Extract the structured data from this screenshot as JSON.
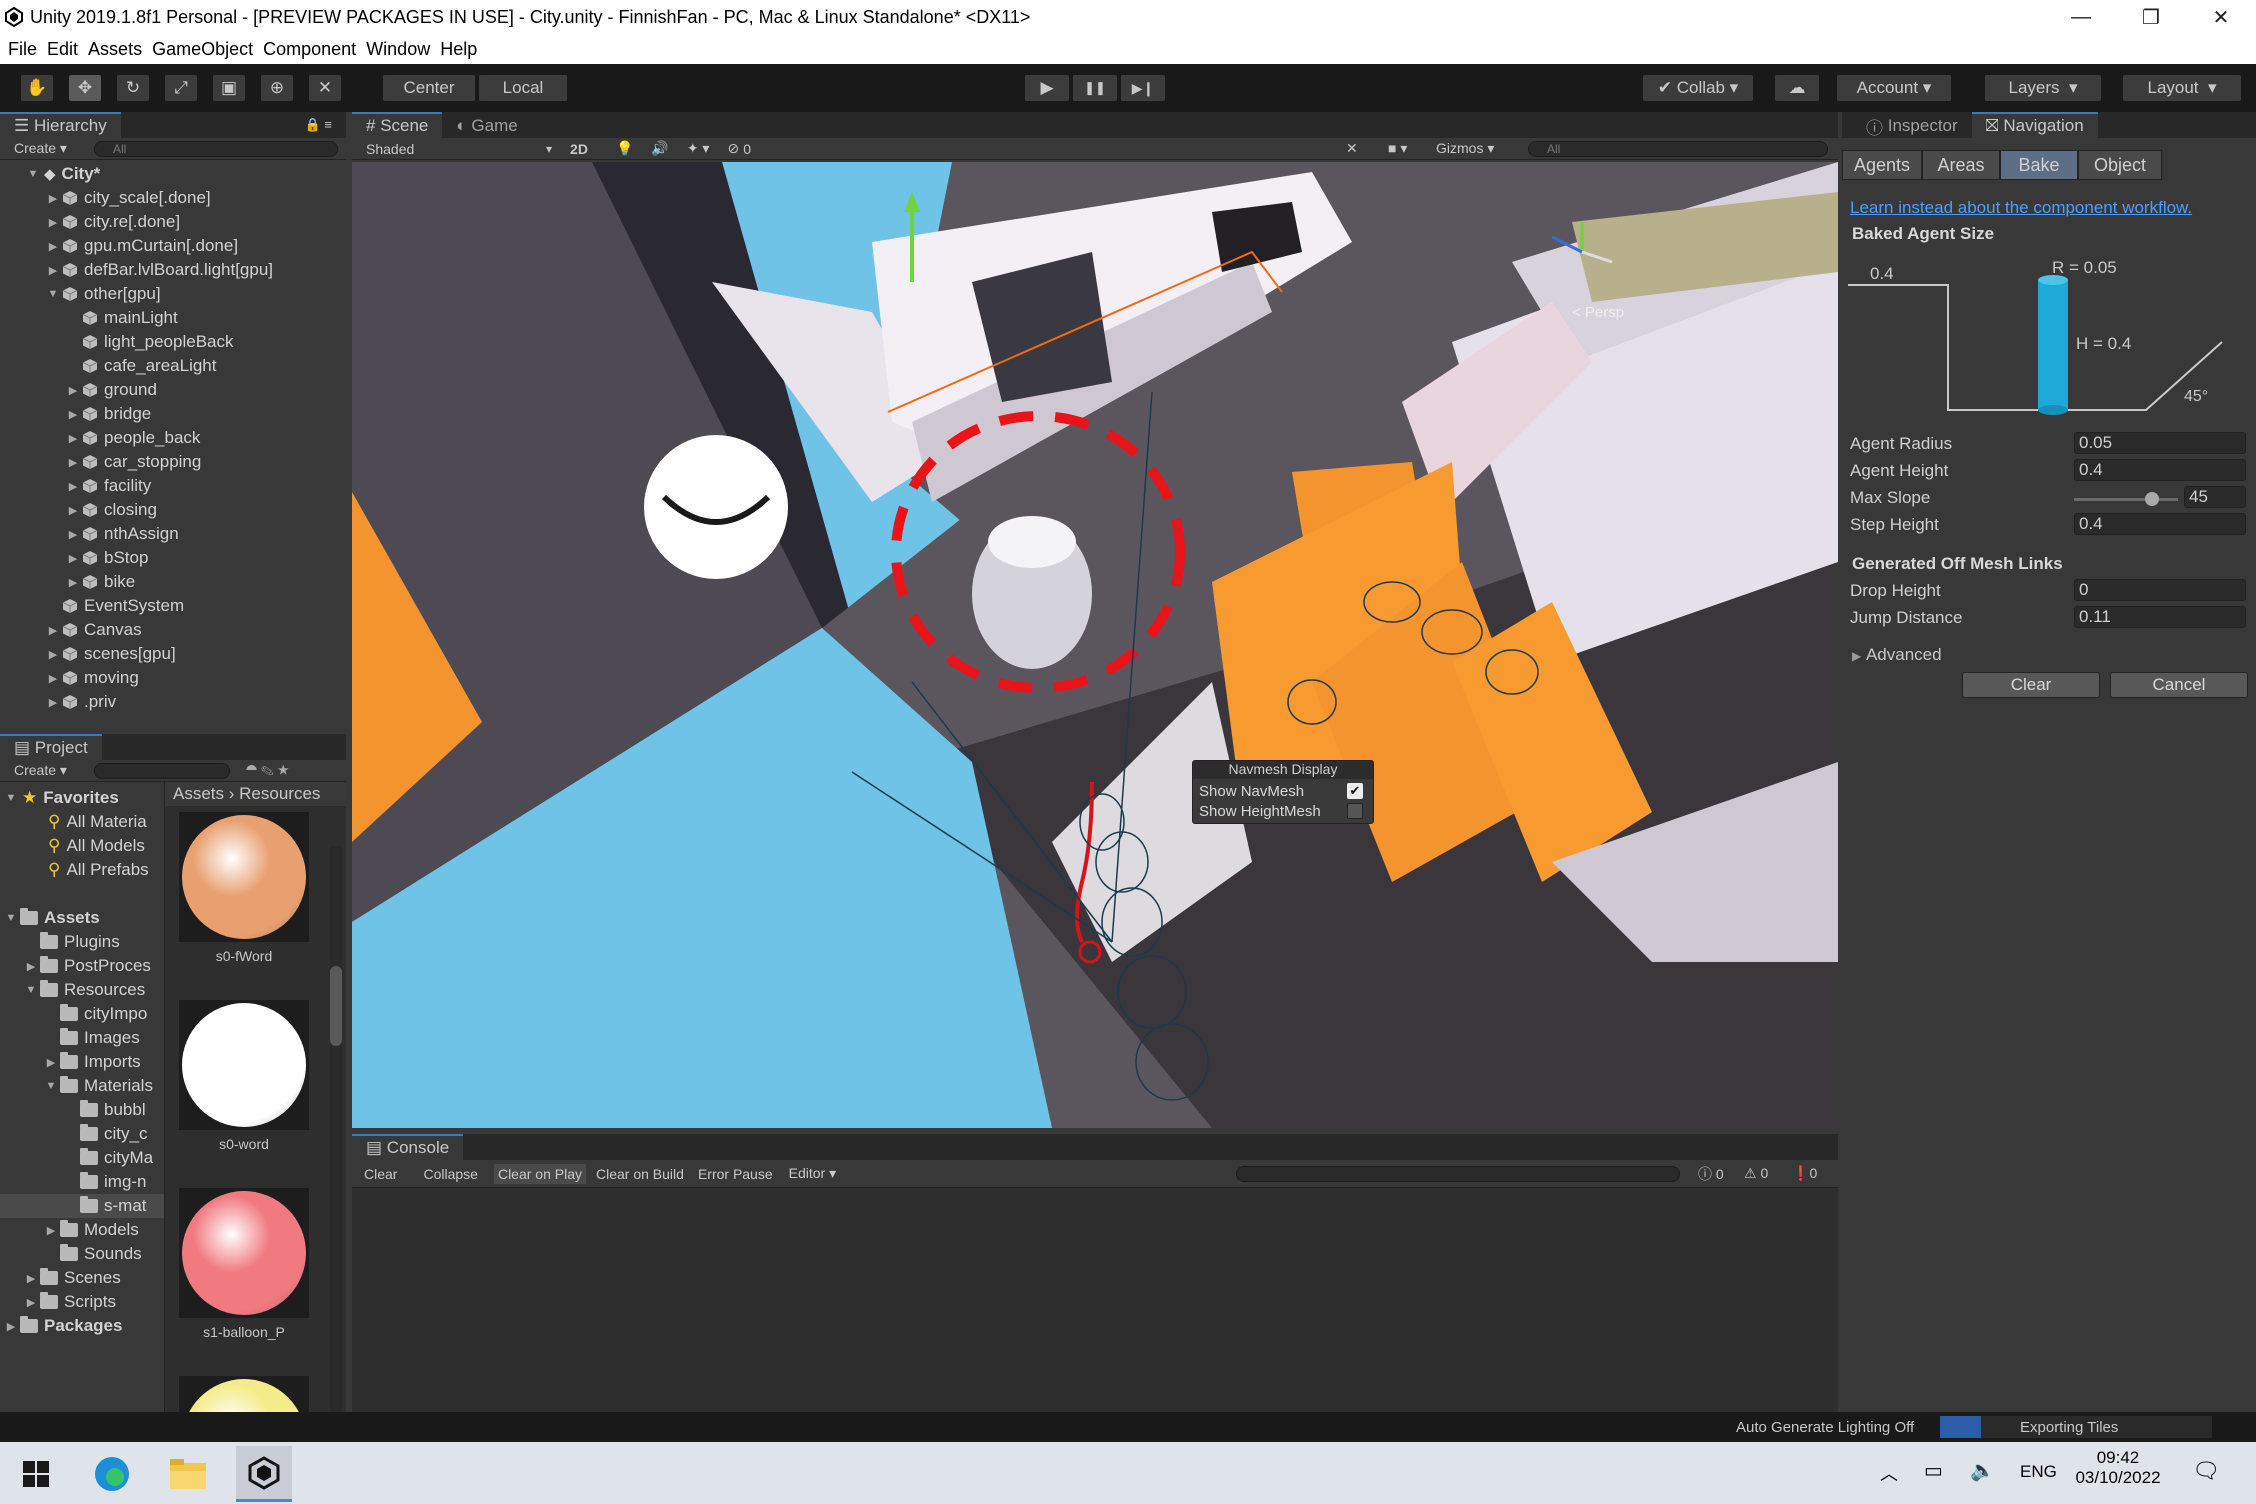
{
  "window": {
    "title": "Unity 2019.1.8f1 Personal - [PREVIEW PACKAGES IN USE] - City.unity - FinnishFan - PC, Mac & Linux Standalone* <DX11>",
    "minimize": "—",
    "restore": "❐",
    "close": "✕"
  },
  "menu": [
    "File",
    "Edit",
    "Assets",
    "GameObject",
    "Component",
    "Window",
    "Help"
  ],
  "toolbar": {
    "pivot_label": "Center",
    "space_label": "Local",
    "collab_label": "Collab",
    "account_label": "Account",
    "layers_label": "Layers",
    "layout_label": "Layout",
    "play_icon": "▶",
    "pause_icon": "❚❚",
    "step_icon": "▶❙"
  },
  "hierarchy": {
    "tab_label": "Hierarchy",
    "create_label": "Create",
    "search_placeholder": "All",
    "scene_name": "City*",
    "items": [
      {
        "label": "city_scale[.done]"
      },
      {
        "label": "city.re[.done]"
      },
      {
        "label": "gpu.mCurtain[.done]"
      },
      {
        "label": "defBar.lvlBoard.light[gpu]"
      },
      {
        "label": "other[gpu]"
      },
      {
        "label": "mainLight"
      },
      {
        "label": "light_peopleBack"
      },
      {
        "label": "cafe_areaLight"
      },
      {
        "label": "ground"
      },
      {
        "label": "bridge"
      },
      {
        "label": "people_back"
      },
      {
        "label": "car_stopping"
      },
      {
        "label": "facility"
      },
      {
        "label": "closing"
      },
      {
        "label": "nthAssign"
      },
      {
        "label": "bStop"
      },
      {
        "label": "bike"
      },
      {
        "label": "EventSystem"
      },
      {
        "label": "Canvas"
      },
      {
        "label": "scenes[gpu]"
      },
      {
        "label": "moving"
      },
      {
        "label": ".priv"
      }
    ]
  },
  "project": {
    "tab_label": "Project",
    "create_label": "Create",
    "favorites_label": "Favorites",
    "favorites": [
      "All Materia",
      "All Models",
      "All Prefabs"
    ],
    "assets_label": "Assets",
    "folders": [
      {
        "label": "Plugins"
      },
      {
        "label": "PostProces"
      },
      {
        "label": "Resources"
      },
      {
        "label": "cityImpo"
      },
      {
        "label": "Images"
      },
      {
        "label": "Imports"
      },
      {
        "label": "Materials"
      },
      {
        "label": "bubbl"
      },
      {
        "label": "city_c"
      },
      {
        "label": "cityMa"
      },
      {
        "label": "img-n"
      },
      {
        "label": "s-mat"
      },
      {
        "label": "Models"
      },
      {
        "label": "Sounds"
      },
      {
        "label": "Scenes"
      },
      {
        "label": "Scripts"
      }
    ],
    "packages_label": "Packages",
    "breadcrumb": [
      "Assets",
      "Resources"
    ],
    "previews": [
      {
        "label": "s0-fWord",
        "color": "#e8a070"
      },
      {
        "label": "s0-word",
        "color": "#ffffff"
      },
      {
        "label": "s1-balloon_P",
        "color": "#f07a80"
      },
      {
        "label": "",
        "color": "#f4ec8a"
      }
    ]
  },
  "scene": {
    "tab_scene": "Scene",
    "tab_game": "Game",
    "shading_mode": "Shaded",
    "mode_2d": "2D",
    "hidden_count": "0",
    "gizmos_label": "Gizmos",
    "search_placeholder": "All",
    "persp_label": "< Persp",
    "navmesh_overlay": {
      "title": "Navmesh Display",
      "show_navmesh": "Show NavMesh",
      "show_navmesh_checked": true,
      "show_heightmesh": "Show HeightMesh",
      "show_heightmesh_checked": false
    }
  },
  "console": {
    "tab_label": "Console",
    "buttons": [
      "Clear",
      "Collapse",
      "Clear on Play",
      "Clear on Build",
      "Error Pause",
      "Editor"
    ],
    "info_count": "0",
    "warn_count": "0",
    "error_count": "0"
  },
  "inspector": {
    "tab_inspector": "Inspector",
    "tab_navigation": "Navigation",
    "nav_tabs": [
      "Agents",
      "Areas",
      "Bake",
      "Object"
    ],
    "active_nav_tab": "Bake",
    "workflow_link": "Learn instead about the component workflow.",
    "baked_agent_size_label": "Baked Agent Size",
    "diagram": {
      "step_label": "0.4",
      "radius_label": "R = 0.05",
      "height_label": "H = 0.4",
      "slope_label": "45°"
    },
    "fields": [
      {
        "label": "Agent Radius",
        "value": "0.05"
      },
      {
        "label": "Agent Height",
        "value": "0.4"
      },
      {
        "label": "Max Slope",
        "value": "45",
        "slider": 0.75
      },
      {
        "label": "Step Height",
        "value": "0.4"
      }
    ],
    "offmesh_header": "Generated Off Mesh Links",
    "offmesh_fields": [
      {
        "label": "Drop Height",
        "value": "0"
      },
      {
        "label": "Jump Distance",
        "value": "0.11"
      }
    ],
    "advanced_label": "Advanced",
    "clear_label": "Clear",
    "cancel_label": "Cancel"
  },
  "statusbar": {
    "lighting": "Auto Generate Lighting Off",
    "progress_label": "Exporting Tiles",
    "progress": 0.15
  },
  "taskbar": {
    "language": "ENG",
    "time": "09:42",
    "date": "03/10/2022"
  }
}
